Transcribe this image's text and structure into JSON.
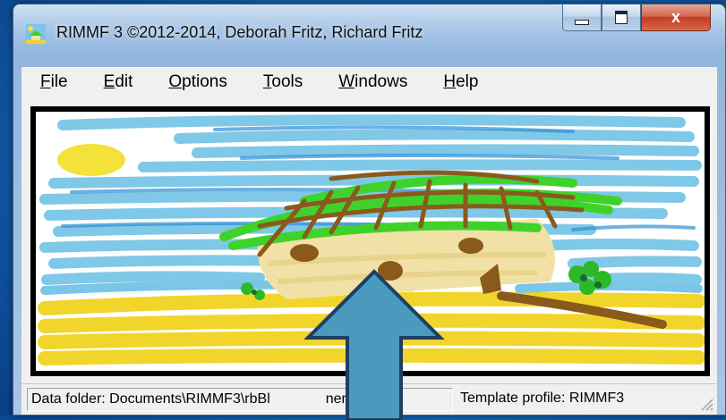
{
  "window": {
    "title": "RIMMF 3   ©2012-2014, Deborah Fritz, Richard Fritz",
    "app_icon": "rimmf-icon",
    "buttons": {
      "minimize": "minimize-icon",
      "maximize": "maximize-icon",
      "close": "x"
    }
  },
  "menu": [
    {
      "underline": "F",
      "rest": "ile"
    },
    {
      "underline": "E",
      "rest": "dit"
    },
    {
      "underline": "O",
      "rest": "ptions"
    },
    {
      "underline": "T",
      "rest": "ools"
    },
    {
      "underline": "W",
      "rest": "indows"
    },
    {
      "underline": "H",
      "rest": "elp"
    }
  ],
  "status": {
    "data_folder": "Data folder: Documents\\RIMMF3\\rbBl",
    "data_folder_tail": "ner\\",
    "template_profile": "Template profile: RIMMF3"
  },
  "colors": {
    "sky": "#79c6e6",
    "sun": "#f4e13a",
    "roof_green": "#3fd22a",
    "roof_brown": "#8a5a1c",
    "wall": "#f2e1a6",
    "sand": "#f2d52a",
    "arrow": "#4a9abd",
    "close_red": "#c23e22"
  },
  "overlay": {
    "arrow_icon": "up-arrow-icon"
  }
}
